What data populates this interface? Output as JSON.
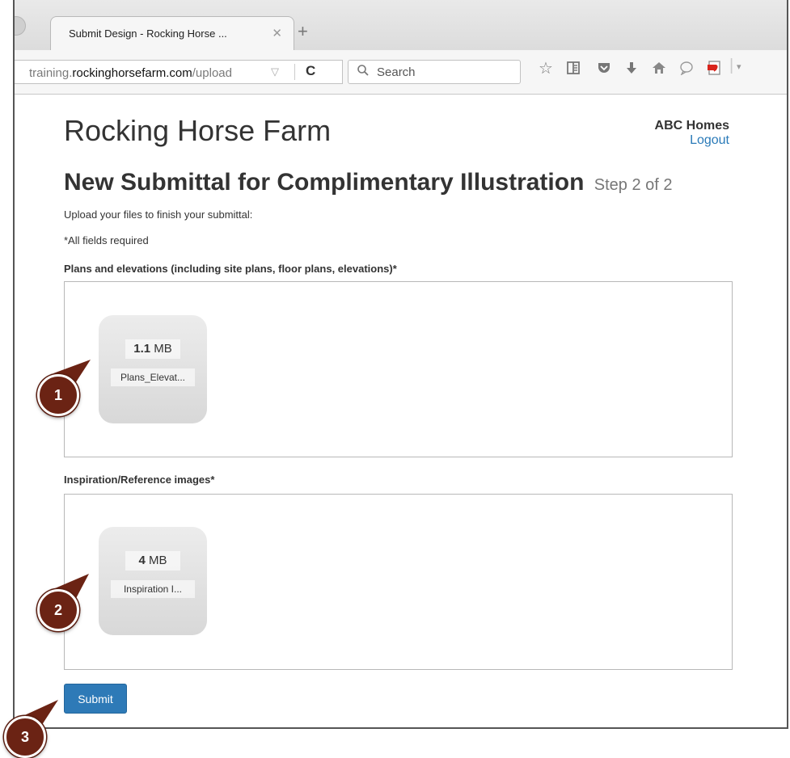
{
  "browser": {
    "tab_title": "Submit Design - Rocking Horse ...",
    "tab_close": "✕",
    "new_tab": "+",
    "url_prefix": "training.",
    "url_domain": "rockinghorsefarm.com",
    "url_path": "/upload",
    "url_dropdown": "▽",
    "reload": "C",
    "search_placeholder": "Search",
    "icons": [
      "star-icon",
      "reading-list-icon",
      "pocket-icon",
      "download-icon",
      "home-icon",
      "chat-icon",
      "pdf-icon"
    ]
  },
  "site": {
    "title": "Rocking Horse Farm",
    "account_name": "ABC Homes",
    "logout_label": "Logout"
  },
  "page": {
    "heading": "New Submittal for Complimentary Illustration",
    "step": "Step 2 of 2",
    "intro": "Upload your files to finish your submittal:",
    "required_note": "*All fields required"
  },
  "fields": [
    {
      "label": "Plans and elevations (including site plans, floor plans, elevations)*",
      "file_size_value": "1.1",
      "file_size_unit": "MB",
      "file_name": "Plans_Elevat..."
    },
    {
      "label": "Inspiration/Reference images*",
      "file_size_value": "4",
      "file_size_unit": "MB",
      "file_name": "Inspiration I..."
    }
  ],
  "submit_label": "Submit",
  "callouts": [
    "1",
    "2",
    "3"
  ],
  "colors": {
    "callout": "#6b2314",
    "link": "#2a7ab8",
    "button": "#2e7ab7"
  }
}
